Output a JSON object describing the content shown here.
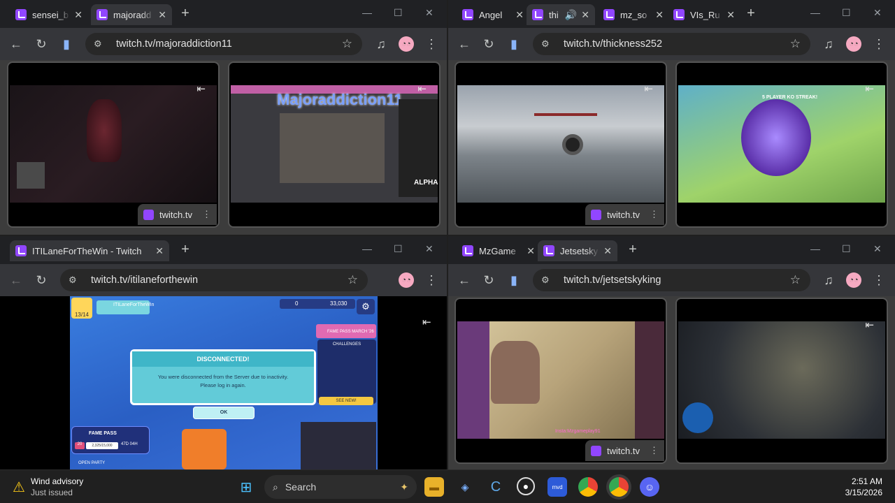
{
  "windows": [
    {
      "tabs": [
        "sensei_b",
        "majoradd"
      ],
      "url": "twitch.tv/majoraddiction11",
      "chip": "twitch.tv"
    },
    {
      "tabs": [
        "Angel",
        "thi",
        "mz_so",
        "VIs_Ru"
      ],
      "url": "twitch.tv/thickness252",
      "chip": "twitch.tv"
    },
    {
      "tabs": [
        "ITILaneForTheWin - Twitch"
      ],
      "url": "twitch.tv/itilaneforthewin"
    },
    {
      "tabs": [
        "MzGame",
        "Jetsetsky"
      ],
      "url": "twitch.tv/jetsetskyking",
      "chip": "twitch.tv"
    }
  ],
  "game_dialog": {
    "title": "DISCONNECTED!",
    "message_line1": "You were disconnected from the Server due to inactivity.",
    "message_line2": "Please log in again.",
    "ok_label": "OK",
    "player_name": "ITILaneForTheWin",
    "level": "13/14",
    "currency_a": "0",
    "currency_b": "33,030",
    "fame_pass_label": "FAME PASS MARCH '26",
    "challenges_label": "CHALLENGES",
    "see_new": "SEE NEW!",
    "fame_pass": "FAME PASS",
    "fame_level": "20",
    "fame_progress": "2,325/15,000",
    "fame_time": "47D 04H",
    "open_party": "OPEN PARTY"
  },
  "stream_overlays": {
    "majoraddiction_banner": "Majoraddiction11",
    "alpha": "ALPHA",
    "ko_streak": "5 PLAYER KO STREAK!",
    "insta": "Insta:Mzgameplay91"
  },
  "taskbar": {
    "weather_title": "Wind advisory",
    "weather_sub": "Just issued",
    "search_placeholder": "Search",
    "time": "2:51 AM",
    "date": "3/15/2026"
  },
  "colors": {
    "twitch_purple": "#9146ff",
    "chrome_dark": "#202124",
    "toolbar": "#35363a"
  }
}
